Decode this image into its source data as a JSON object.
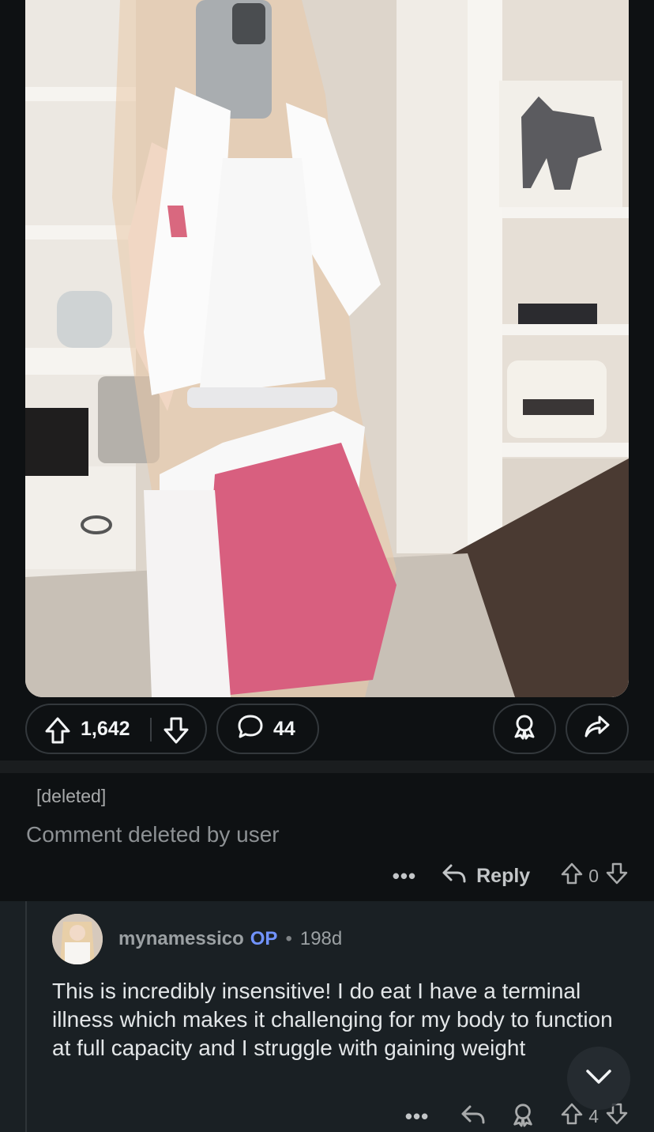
{
  "post": {
    "image_alt": "Cosplayer mirror selfie in white and pink outfit",
    "upvote_count": "1,642",
    "comment_count": "44"
  },
  "deleted_comment": {
    "author": "[deleted]",
    "body": "Comment deleted by user",
    "more": "•••",
    "reply_label": "Reply",
    "score": "0"
  },
  "reply_comment": {
    "username": "mynamessico",
    "op_badge": "OP",
    "separator": "•",
    "age": "198d",
    "body": "This is incredibly insensitive! I do eat I have a terminal illness which makes it challenging for my body to function at full capacity and I struggle with gaining weight",
    "more": "•••",
    "score": "4"
  },
  "colors": {
    "background": "#0e1113",
    "thread_background": "#1a2024",
    "op_accent": "#7193ff"
  }
}
